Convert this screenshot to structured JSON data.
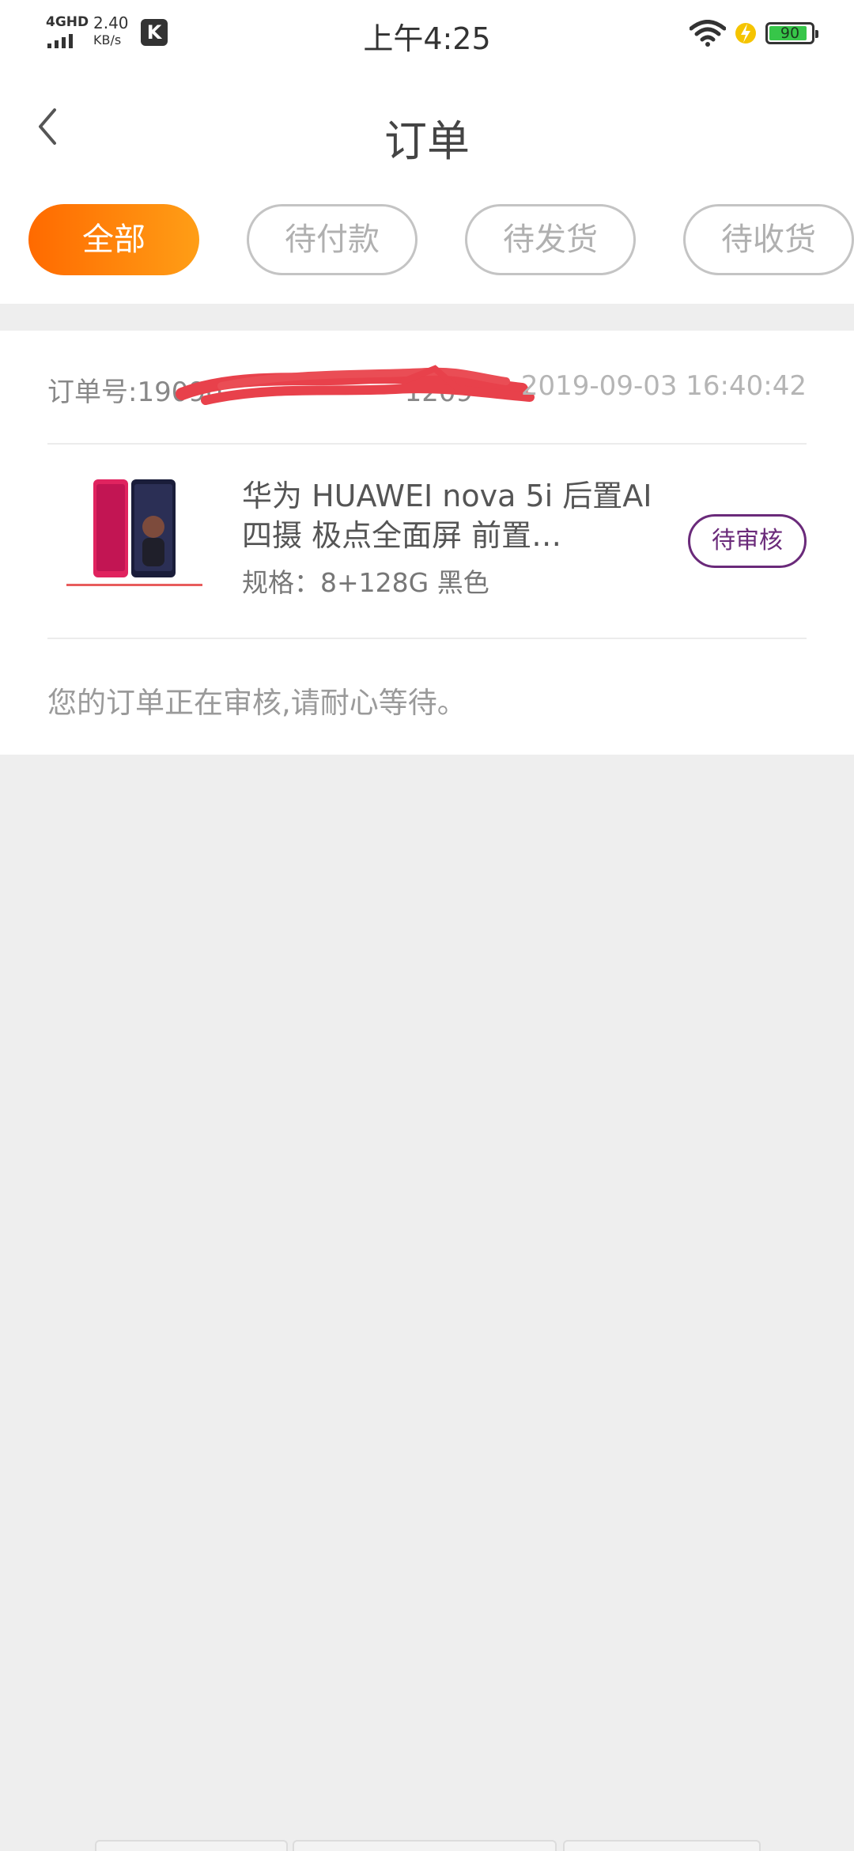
{
  "status_bar": {
    "network": "4GHD",
    "speed_value": "2.40",
    "speed_unit": "KB/s",
    "app_badge": "K",
    "time": "上午4:25",
    "battery": "90"
  },
  "header": {
    "title": "订单"
  },
  "tabs": [
    {
      "label": "全部",
      "active": true
    },
    {
      "label": "待付款",
      "active": false
    },
    {
      "label": "待发货",
      "active": false
    },
    {
      "label": "待收货",
      "active": false
    }
  ],
  "order": {
    "number_label": "订单号:19090",
    "number_tail": "1209",
    "time": "2019-09-03 16:40:42",
    "product_name": "华为 HUAWEI nova 5i 后置AI四摄 极点全面屏 前置…",
    "spec": "规格：8+128G 黑色",
    "status": "待审核",
    "message": "您的订单正在审核,请耐心等待。"
  },
  "colors": {
    "accent_start": "#ff6a00",
    "accent_end": "#ff9e16",
    "status_badge": "#6a2a7a",
    "redaction": "#e8414b"
  }
}
